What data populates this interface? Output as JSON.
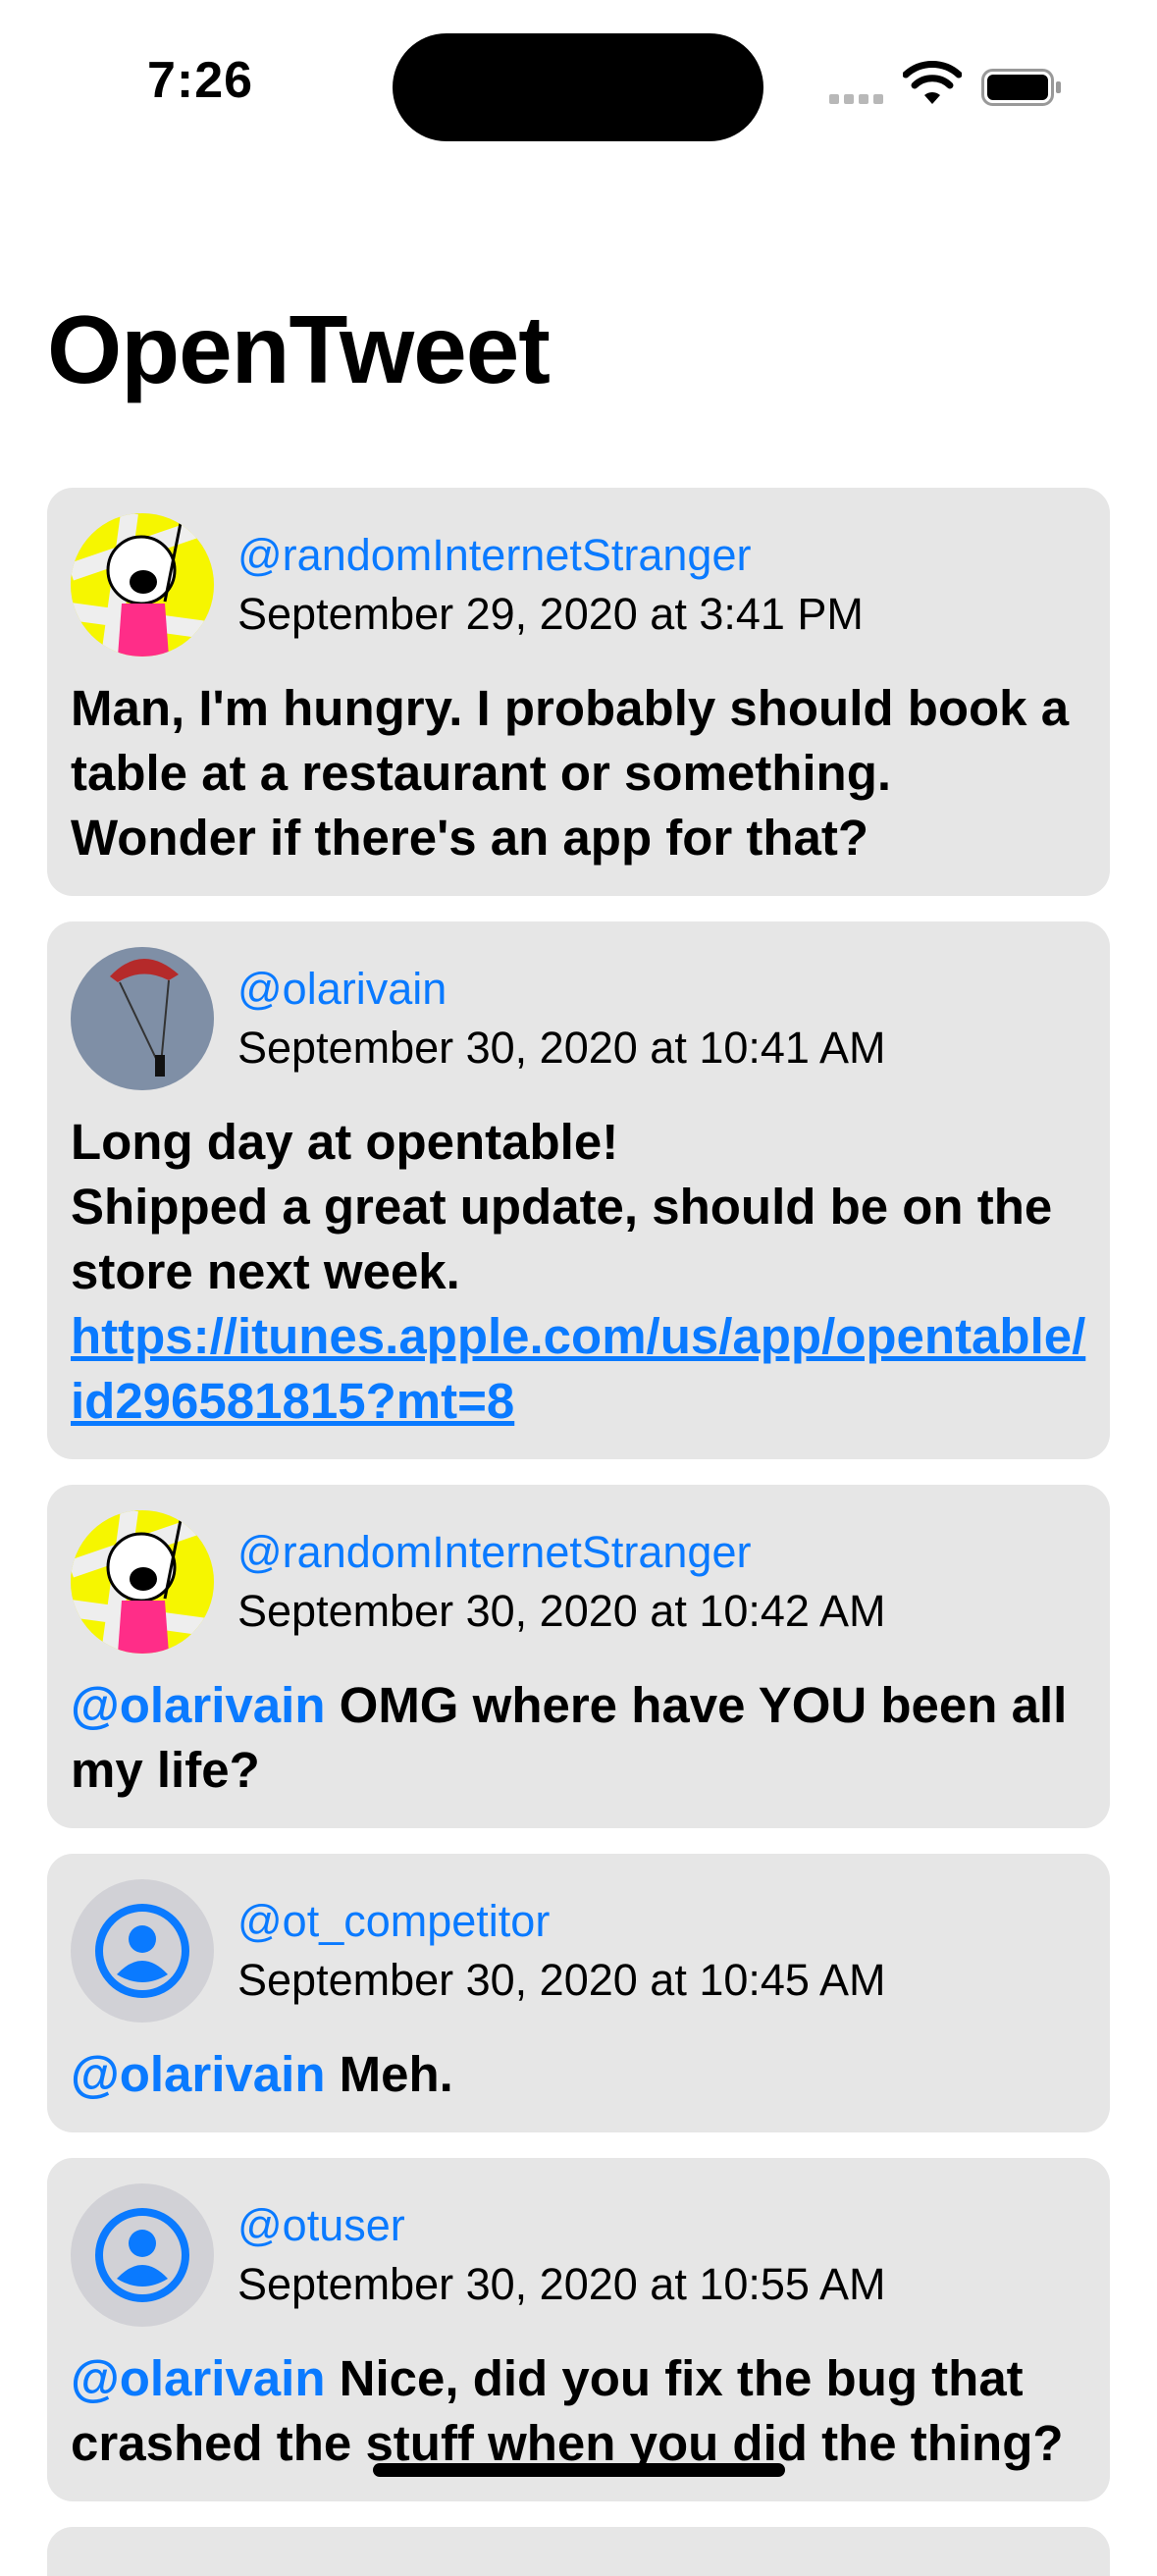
{
  "status_bar": {
    "time": "7:26"
  },
  "app": {
    "title": "OpenTweet"
  },
  "tweets": [
    {
      "handle": "@randomInternetStranger",
      "date": "September 29, 2020 at 3:41 PM",
      "avatar": "all-the-things-avatar",
      "body": [
        {
          "type": "text",
          "value": "Man, I'm hungry. I probably should book a table at a restaurant or something. Wonder if there's an app for that?"
        }
      ]
    },
    {
      "handle": "@olarivain",
      "date": "September 30, 2020 at 10:41 AM",
      "avatar": "parachute-photo-avatar",
      "body": [
        {
          "type": "text",
          "value": "Long day at opentable!\nShipped a great update, should be on the store next week."
        },
        {
          "type": "link",
          "value": "https://itunes.apple.com/us/app/opentable/id296581815?mt=8"
        }
      ]
    },
    {
      "handle": "@randomInternetStranger",
      "date": "September 30, 2020 at 10:42 AM",
      "avatar": "all-the-things-avatar",
      "body": [
        {
          "type": "mention",
          "value": "@olarivain"
        },
        {
          "type": "text",
          "value": " OMG where have YOU been all my life?"
        }
      ]
    },
    {
      "handle": "@ot_competitor",
      "date": "September 30, 2020 at 10:45 AM",
      "avatar": "person-circle-icon",
      "body": [
        {
          "type": "mention",
          "value": "@olarivain"
        },
        {
          "type": "text",
          "value": " Meh."
        }
      ]
    },
    {
      "handle": "@otuser",
      "date": "September 30, 2020 at 10:55 AM",
      "avatar": "person-circle-icon",
      "body": [
        {
          "type": "mention",
          "value": "@olarivain"
        },
        {
          "type": "text",
          "value": " Nice, did you fix the bug that crashed the stuff when you did the thing?"
        }
      ]
    }
  ],
  "colors": {
    "accent": "#0a7aff",
    "card": "#e6e6e6",
    "avatar_bg": "#d1d1d6"
  }
}
